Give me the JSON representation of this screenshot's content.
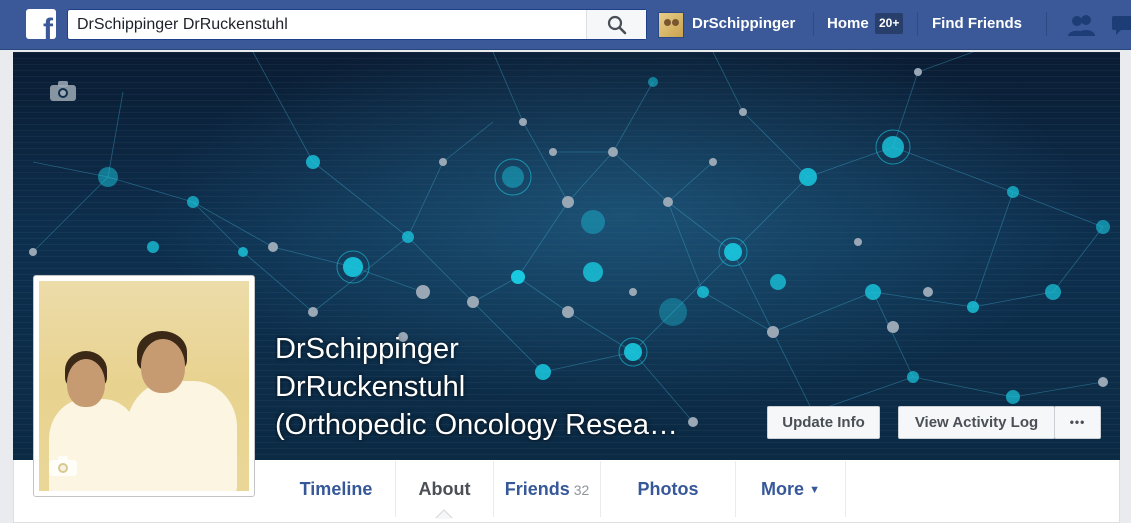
{
  "topbar": {
    "logo": "f",
    "search": {
      "value": "DrSchippinger DrRuckenstuhl",
      "placeholder": "Search Facebook",
      "icon": "search-icon"
    },
    "user_name": "DrSchippinger",
    "home_label": "Home",
    "home_badge": "20+",
    "find_friends_label": "Find Friends",
    "icons": [
      "friend-requests-icon",
      "messages-icon"
    ]
  },
  "profile": {
    "name_line1": "DrSchippinger",
    "name_line2": "DrRuckenstuhl",
    "name_line3": "(Orthopedic Oncology Resea…",
    "update_info_label": "Update Info",
    "activity_log_label": "View Activity Log",
    "more_options_label": "•••"
  },
  "tabs": [
    {
      "label": "Timeline"
    },
    {
      "label": "About",
      "active": true
    },
    {
      "label": "Friends",
      "count": "32"
    },
    {
      "label": "Photos"
    },
    {
      "label": "More",
      "caret": "▼"
    }
  ],
  "colors": {
    "brand": "#3b5998",
    "link": "#365899",
    "cover_dark": "#0a1c33",
    "node_cyan": "#19c9e0"
  }
}
